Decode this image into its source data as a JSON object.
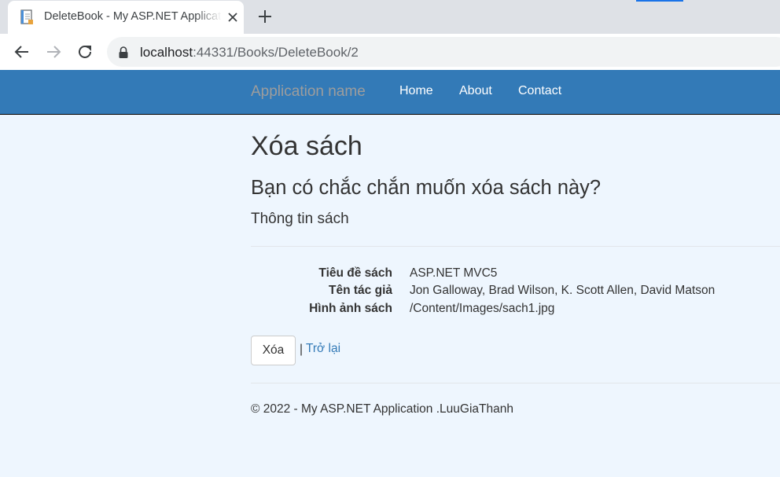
{
  "browser": {
    "tab": {
      "title": "DeleteBook - My ASP.NET Application",
      "favicon": "document-icon"
    },
    "new_tab_icon": "plus-icon",
    "url_host": "localhost",
    "url_rest": ":44331/Books/DeleteBook/2"
  },
  "navbar": {
    "brand": "Application name",
    "links": [
      {
        "label": "Home"
      },
      {
        "label": "About"
      },
      {
        "label": "Contact"
      }
    ]
  },
  "page": {
    "title": "Xóa sách",
    "question": "Bạn có chắc chắn muốn xóa sách này?",
    "subheading": "Thông tin sách",
    "fields": [
      {
        "term": "Tiêu đề sách",
        "value": "ASP.NET MVC5"
      },
      {
        "term": "Tên tác giả",
        "value": "Jon Galloway, Brad Wilson, K. Scott Allen, David Matson"
      },
      {
        "term": "Hình ảnh sách",
        "value": "/Content/Images/sach1.jpg"
      }
    ],
    "delete_button": "Xóa",
    "separator": "|",
    "back_link": "Trở lại"
  },
  "footer": {
    "text": "© 2022 - My ASP.NET Application .LuuGiaThanh"
  },
  "colors": {
    "navbar": "#337ab7",
    "page_background": "#eef6fe",
    "link": "#337ab7",
    "brand": "#9d9d9d"
  }
}
